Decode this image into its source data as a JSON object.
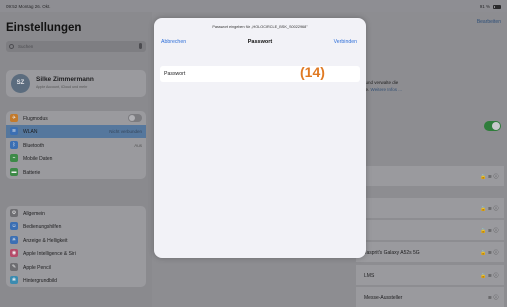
{
  "status_bar": {
    "time": "09:52  Montag 26. Okt.",
    "battery": "91 %"
  },
  "sidebar": {
    "title": "Einstellungen",
    "search_placeholder": "Suchen",
    "profile": {
      "initials": "SZ",
      "name": "Silke Zimmermann",
      "subtitle": "Apple Account, iCloud und mehr"
    },
    "group1": [
      {
        "label": "Flugmodus",
        "value": "",
        "icon": "airplane-icon",
        "color": "#c27a2c"
      },
      {
        "label": "WLAN",
        "value": "Nicht verbunden",
        "icon": "wifi-icon",
        "color": "#3b6fb3",
        "selected": true
      },
      {
        "label": "Bluetooth",
        "value": "Aus",
        "icon": "bluetooth-icon",
        "color": "#3b6fb3"
      },
      {
        "label": "Mobile Daten",
        "value": "",
        "icon": "antenna-icon",
        "color": "#3d8a47"
      },
      {
        "label": "Batterie",
        "value": "",
        "icon": "battery-icon",
        "color": "#3d8a47"
      }
    ],
    "group2": [
      {
        "label": "Allgemein",
        "icon": "gear-icon",
        "color": "#6d6d71"
      },
      {
        "label": "Bedienungshilfen",
        "icon": "accessibility-icon",
        "color": "#3b6fb3"
      },
      {
        "label": "Anzeige & Helligkeit",
        "icon": "sun-icon",
        "color": "#3b6fb3"
      },
      {
        "label": "Apple Intelligence & Siri",
        "icon": "siri-icon",
        "color": "#b54c6a"
      },
      {
        "label": "Apple Pencil",
        "icon": "pencil-icon",
        "color": "#6d6d71"
      },
      {
        "label": "Hintergrundbild",
        "icon": "wallpaper-icon",
        "color": "#3b8bb0"
      }
    ]
  },
  "main": {
    "edit_label": "Bearbeiten",
    "wlan_text_1": "etzwerke an und verwalte die",
    "wlan_text_2": "ts in der Nähe.",
    "wlan_link": "Weitere Infos ...",
    "networks": [
      {
        "name": ""
      },
      {
        "name": ""
      },
      {
        "name": ""
      },
      {
        "name": "Jasprit's Galaxy A52s 5G"
      },
      {
        "name": "LMS"
      },
      {
        "name": "Messe-Aussteller"
      }
    ]
  },
  "modal": {
    "prompt": "Passwort eingeben für „HOLOCIRCLE_BSK_S0022968\"",
    "cancel_label": "Abbrechen",
    "title": "Passwort",
    "connect_label": "Verbinden",
    "field_label": "Passwort",
    "field_value": ""
  },
  "annotation": "(14)"
}
